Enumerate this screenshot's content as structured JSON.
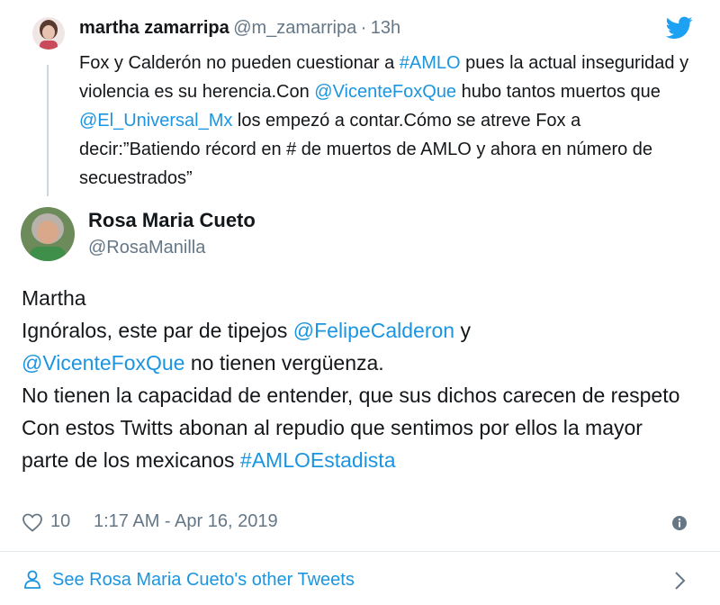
{
  "reply": {
    "name": "martha zamarripa",
    "handle": "@m_zamarripa",
    "separator": "·",
    "time": "13h",
    "text": [
      {
        "t": "Fox y Calderón no pueden cuestionar a ",
        "link": false
      },
      {
        "t": "#AMLO",
        "link": true
      },
      {
        "t": " pues la actual inseguridad y violencia es su herencia.Con ",
        "link": false
      },
      {
        "t": "@VicenteFoxQue",
        "link": true
      },
      {
        "t": " hubo tantos muertos que ",
        "link": false
      },
      {
        "t": "@El_Universal_Mx",
        "link": true
      },
      {
        "t": " los empezó a contar.Cómo se atreve Fox a decir:”Batiendo récord en # de muertos de AMLO y ahora en número de secuestrados”",
        "link": false
      }
    ]
  },
  "tweet": {
    "name": "Rosa Maria Cueto",
    "handle": "@RosaManilla",
    "text": [
      {
        "t": "Martha\nIgnóralos, este par de tipejos ",
        "link": false
      },
      {
        "t": "@FelipeCalderon",
        "link": true
      },
      {
        "t": " y\n",
        "link": false
      },
      {
        "t": "@VicenteFoxQue",
        "link": true
      },
      {
        "t": " no tienen vergüenza.\nNo tienen la capacidad de entender, que sus dichos carecen de respeto\nCon estos Twitts abonan al repudio que sentimos por ellos la mayor parte de los mexicanos ",
        "link": false
      },
      {
        "t": "#AMLOEstadista",
        "link": true
      }
    ],
    "likes": "10",
    "timestamp": "1:17 AM - Apr 16, 2019"
  },
  "footer": {
    "see_more": "See Rosa Maria Cueto's other Tweets"
  },
  "colors": {
    "link": "#1b95e0",
    "secondary": "#657786",
    "twitter_blue": "#1da1f2"
  }
}
